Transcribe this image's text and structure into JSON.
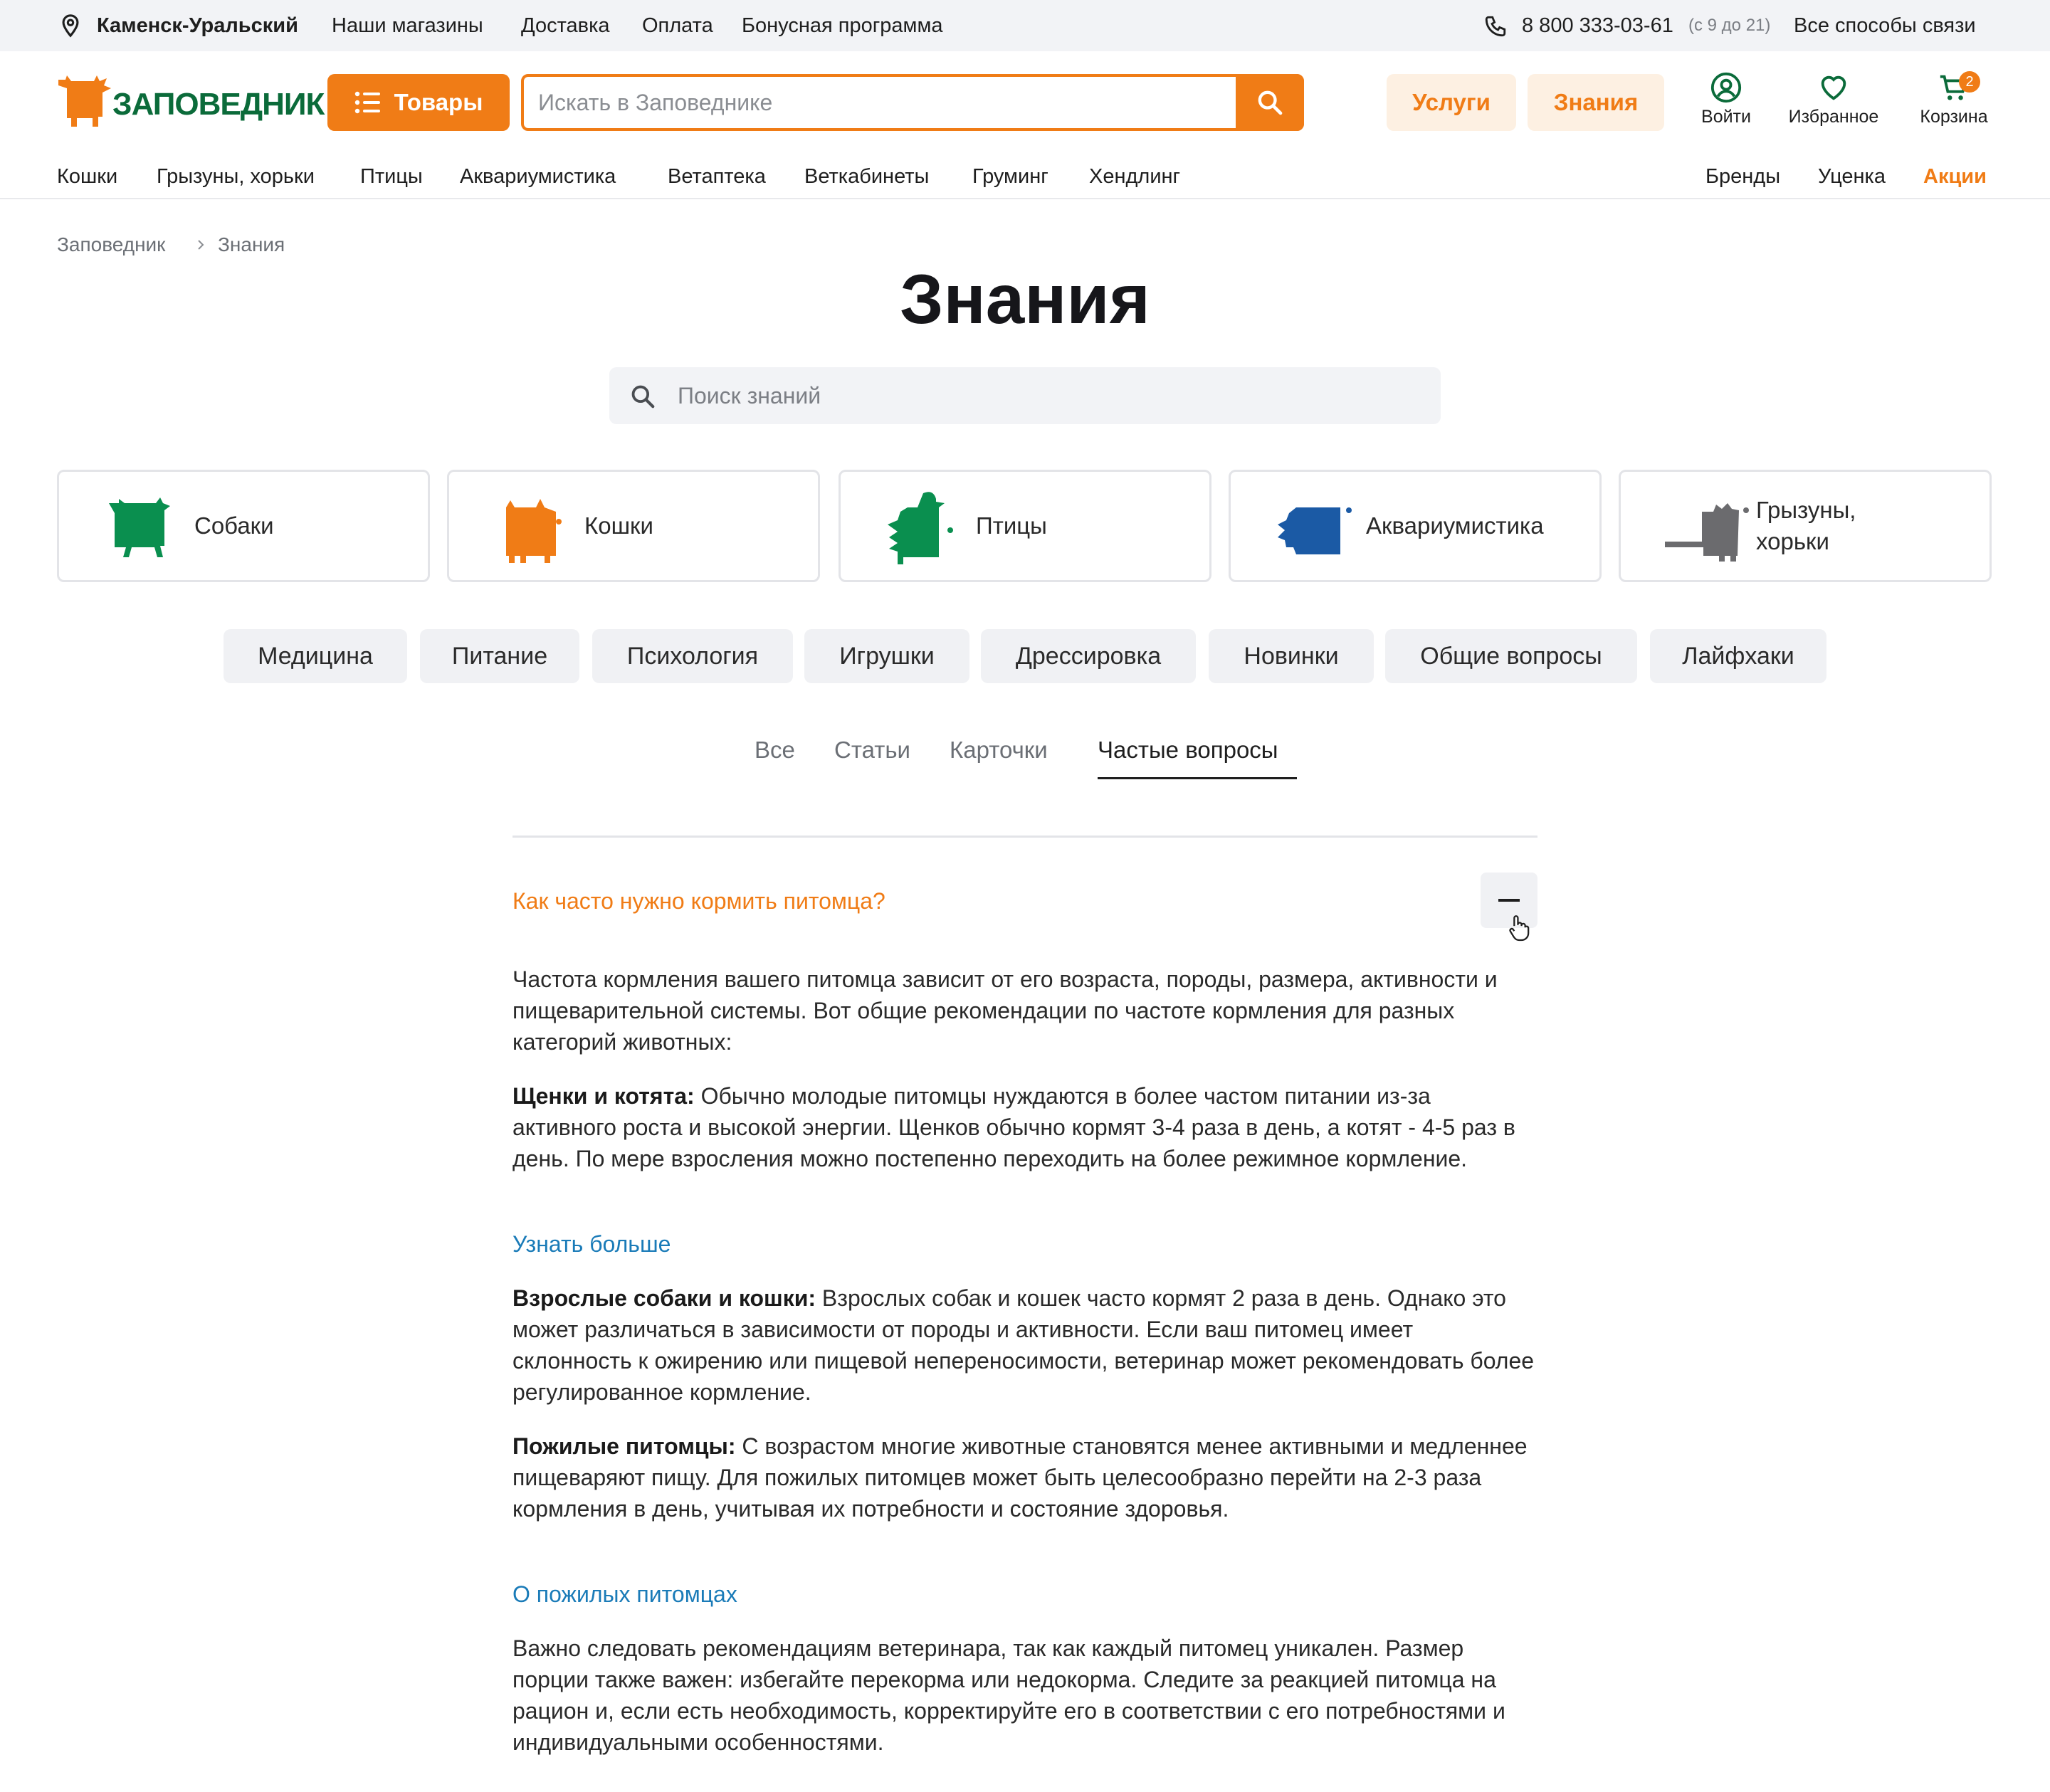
{
  "topbar": {
    "city": "Каменск-Уральский",
    "links": [
      "Наши магазины",
      "Доставка",
      "Оплата",
      "Бонусная программа"
    ],
    "phone": "8 800 333-03-61",
    "hours": "(с 9 до 21)",
    "contacts": "Все способы связи"
  },
  "header": {
    "logo_text": "ЗАПОВЕДНИК",
    "goods_button": "Товары",
    "search_placeholder": "Искать в Заповеднике",
    "services": "Услуги",
    "knowledge": "Знания",
    "login": "Войти",
    "favorites": "Избранное",
    "cart": "Корзина",
    "cart_count": "2",
    "accent_color": "#f07c16",
    "brand_green": "#0b6b3a"
  },
  "nav": {
    "left": [
      "Кошки",
      "Грызуны, хорьки",
      "Птицы",
      "Аквариумистика",
      "Ветаптека",
      "Веткабинеты",
      "Груминг",
      "Хендлинг"
    ],
    "right": [
      "Бренды",
      "Уценка",
      "Акции"
    ]
  },
  "breadcrumb": [
    "Заповедник",
    "Знания"
  ],
  "page_title": "Знания",
  "knowledge_search_placeholder": "Поиск знаний",
  "categories": [
    {
      "label": "Собаки",
      "color": "#0a8f4f"
    },
    {
      "label": "Кошки",
      "color": "#f07c16"
    },
    {
      "label": "Птицы",
      "color": "#0a8f4f"
    },
    {
      "label": "Аквариумистика",
      "color": "#1b5aa5"
    },
    {
      "label": "Грызуны, хорьки",
      "color": "#6b6b6e"
    }
  ],
  "topics": [
    "Медицина",
    "Питание",
    "Психология",
    "Игрушки",
    "Дрессировка",
    "Новинки",
    "Общие вопросы",
    "Лайфхаки"
  ],
  "tabs": [
    "Все",
    "Статьи",
    "Карточки",
    "Частые вопросы"
  ],
  "active_tab": "Частые вопросы",
  "faq": {
    "question": "Как часто нужно кормить питомца?",
    "intro": "Частота кормления вашего питомца зависит от его возраста, породы, размера, активности и пищеварительной системы. Вот общие рекомендации по частоте кормления для разных категорий животных:",
    "young_title": "Щенки и котята:",
    "young_text": " Обычно молодые питомцы нуждаются в более частом питании из-за активного роста и высокой энергии. Щенков обычно кормят 3-4 раза в день, а котят - 4-5 раз в день. По мере взросления можно постепенно переходить на более режимное кормление.",
    "link1": "Узнать больше",
    "adult_title": "Взрослые собаки и кошки:",
    "adult_text": " Взрослых собак и кошек часто кормят 2 раза в день. Однако это может различаться в зависимости от породы и активности. Если ваш питомец имеет склонность к ожирению или пищевой непереносимости, ветеринар может рекомендовать более регулированное кормление.",
    "senior_title": "Пожилые питомцы:",
    "senior_text": " С возрастом многие животные становятся менее активными и медленнее пищеваряют пищу. Для пожилых питомцев может быть целесообразно перейти на 2-3 раза кормления в день, учитывая их потребности и состояние здоровья.",
    "link2": "О пожилых питомцах",
    "outro": "Важно следовать рекомендациям ветеринара, так как каждый питомец уникален. Размер порции также важен: избегайте перекорма или недокорма. Следите за реакцией питомца на рацион и, если есть необходимость, корректируйте его в соответствии с его потребностями и индивидуальными особенностями."
  }
}
